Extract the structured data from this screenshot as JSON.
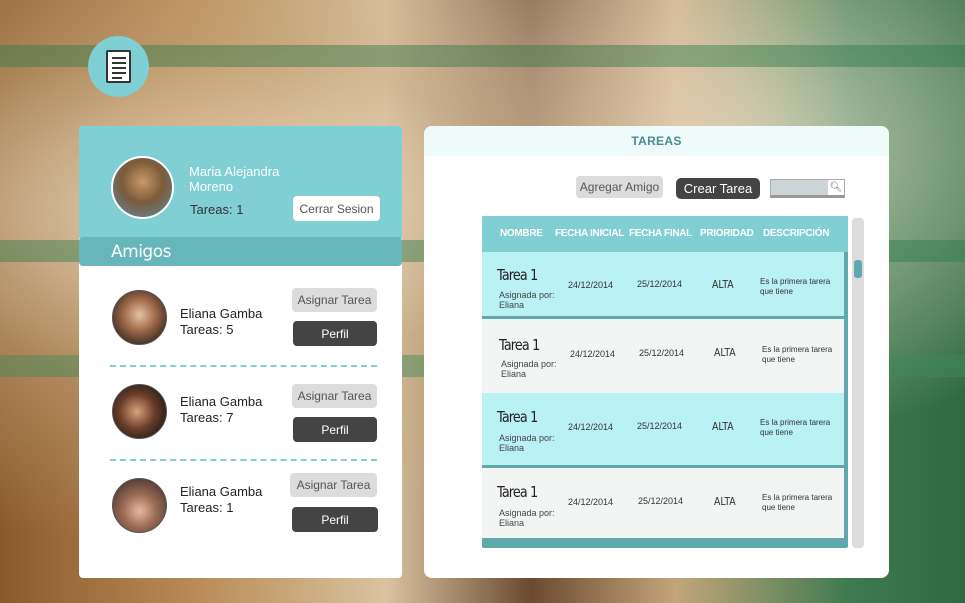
{
  "profile": {
    "name": "Maria Alejandra Moreno",
    "tasks": "Tareas: 1",
    "logout_label": "Cerrar Sesion"
  },
  "friends": {
    "title": "Amigos",
    "items": [
      {
        "name": "Eliana Gamba",
        "tasks": "Tareas: 5",
        "assign_label": "Asignar Tarea",
        "profile_label": "Perfil"
      },
      {
        "name": "Eliana Gamba",
        "tasks": "Tareas: 7",
        "assign_label": "Asignar Tarea",
        "profile_label": "Perfil"
      },
      {
        "name": "Eliana Gamba",
        "tasks": "Tareas: 1",
        "assign_label": "Asignar Tarea",
        "profile_label": "Perfil"
      }
    ]
  },
  "tasks_panel": {
    "title": "TAREAS",
    "add_friend_label": "Agregar Amigo",
    "create_task_label": "Crear Tarea",
    "search_icon": "search-icon",
    "columns": [
      "NOMBRE",
      "FECHA INICIAL",
      "FECHA FINAL",
      "PRIORIDAD",
      "DESCRIPCIÓN"
    ],
    "rows": [
      {
        "name": "Tarea 1",
        "assigned": "Asignada por: Eliana",
        "start": "24/12/2014",
        "end": "25/12/2014",
        "priority": "ALTA",
        "description": "Es la primera tarera que tiene"
      },
      {
        "name": "Tarea 1",
        "assigned": "Asignada por: Eliana",
        "start": "24/12/2014",
        "end": "25/12/2014",
        "priority": "ALTA",
        "description": "Es la primera tarera que tiene"
      },
      {
        "name": "Tarea 1",
        "assigned": "Asignada por: Eliana",
        "start": "24/12/2014",
        "end": "25/12/2014",
        "priority": "ALTA",
        "description": "Es la primera tarera que tiene"
      },
      {
        "name": "Tarea 1",
        "assigned": "Asignada por: Eliana",
        "start": "24/12/2014",
        "end": "25/12/2014",
        "priority": "ALTA",
        "description": "Es la primera tarera que tiene"
      }
    ]
  },
  "colors": {
    "accent": "#7fcfd4",
    "accent_dark": "#66b6bb",
    "row_cyan": "#b9f1f4",
    "button_dark": "#444444"
  }
}
